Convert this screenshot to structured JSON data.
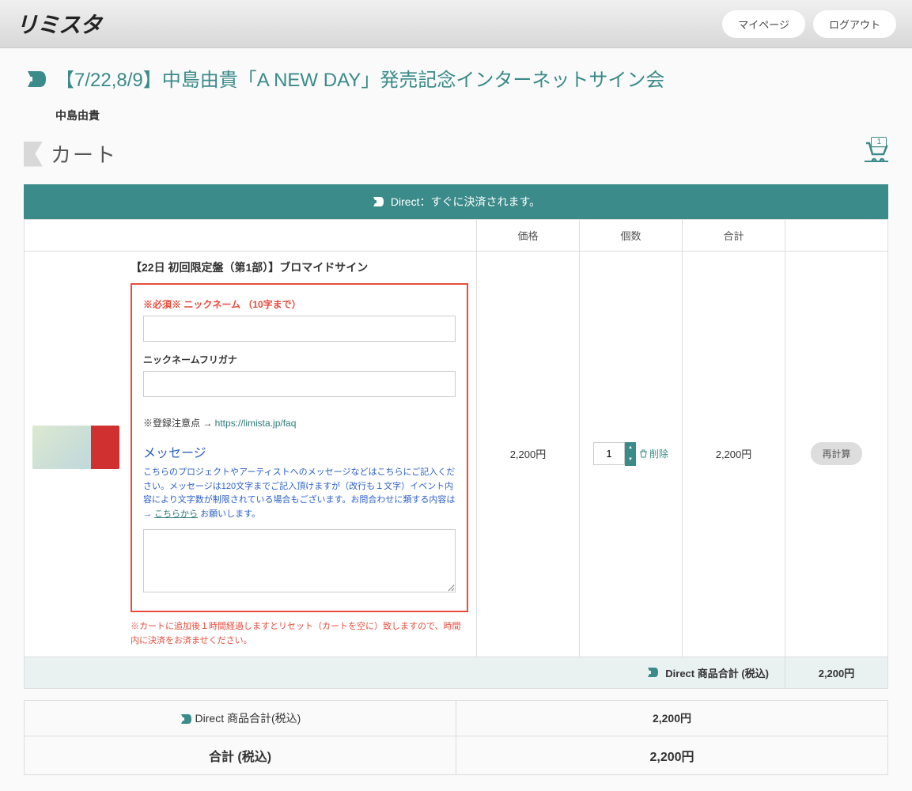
{
  "header": {
    "logo": "リミスタ",
    "mypage": "マイページ",
    "logout": "ログアウト"
  },
  "event": {
    "title": "【7/22,8/9】中島由貴「A NEW DAY」発売記念インターネットサイン会",
    "artist": "中島由貴"
  },
  "cart": {
    "title": "カート",
    "badge_count": "1",
    "direct_banner": "Direct：すぐに決済されます。"
  },
  "columns": {
    "price": "価格",
    "qty": "個数",
    "total": "合計"
  },
  "item": {
    "name": "【22日 初回限定盤（第1部）】ブロマイドサイン",
    "required_marker": "※必須※",
    "nickname_label": " ニックネーム （10字まで）",
    "furigana_label": "ニックネームフリガナ",
    "note_prefix": "※登録注意点 → ",
    "note_link": "https://limista.jp/faq",
    "msg_title": "メッセージ",
    "msg_desc_1": "こちらのプロジェクトやアーティストへのメッセージなどはこちらにご記入ください。メッセージは120文字までご記入頂けますが（改行も１文字）イベント内容により文字数が制限されている場合もございます。お問合わせに類する内容は → ",
    "msg_link": "こちらから",
    "msg_desc_2": " お願いします。",
    "reset_note": "※カートに追加後１時間経過しますとリセット（カートを空に）致しますので、時間内に決済をお済ませください。",
    "price": "2,200円",
    "qty_value": "1",
    "delete": "削除",
    "line_total": "2,200円",
    "recalc": "再計算"
  },
  "subtotal": {
    "label": "Direct 商品合計 (税込)",
    "value": "2,200円"
  },
  "summary": {
    "direct_label": "Direct 商品合計(税込)",
    "direct_value": "2,200円",
    "total_label": "合計 (税込)",
    "total_value": "2,200円"
  }
}
